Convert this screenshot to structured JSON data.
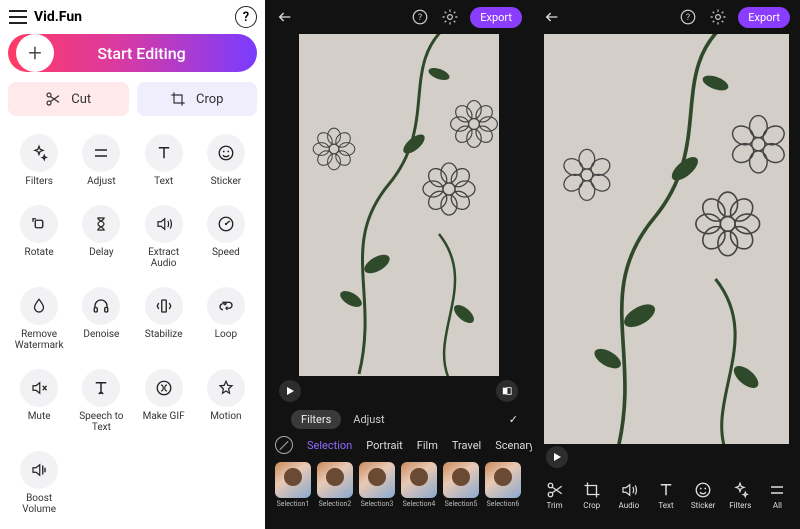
{
  "panel_left": {
    "brand": "Vid.Fun",
    "start_label": "Start Editing",
    "cut_label": "Cut",
    "crop_label": "Crop",
    "tools": [
      {
        "name": "filters",
        "label": "Filters",
        "icon": "sparkle"
      },
      {
        "name": "adjust",
        "label": "Adjust",
        "icon": "equals"
      },
      {
        "name": "text",
        "label": "Text",
        "icon": "text"
      },
      {
        "name": "sticker",
        "label": "Sticker",
        "icon": "smile"
      },
      {
        "name": "rotate",
        "label": "Rotate",
        "icon": "rotate"
      },
      {
        "name": "delay",
        "label": "Delay",
        "icon": "hourglass"
      },
      {
        "name": "extract-audio",
        "label": "Extract Audio",
        "icon": "volume"
      },
      {
        "name": "speed",
        "label": "Speed",
        "icon": "gauge"
      },
      {
        "name": "remove-watermark",
        "label": "Remove Watermark",
        "icon": "drop"
      },
      {
        "name": "denoise",
        "label": "Denoise",
        "icon": "headphones"
      },
      {
        "name": "stabilize",
        "label": "Stabilize",
        "icon": "stabilize"
      },
      {
        "name": "loop",
        "label": "Loop",
        "icon": "loop"
      },
      {
        "name": "mute",
        "label": "Mute",
        "icon": "mute"
      },
      {
        "name": "speech-to-text",
        "label": "Speech to Text",
        "icon": "stt"
      },
      {
        "name": "make-gif",
        "label": "Make GIF",
        "icon": "gif"
      },
      {
        "name": "motion",
        "label": "Motion",
        "icon": "star"
      },
      {
        "name": "boost-volume",
        "label": "Boost Volume",
        "icon": "boost"
      }
    ]
  },
  "panel_center": {
    "export_label": "Export",
    "tab_filters": "Filters",
    "tab_adjust": "Adjust",
    "categories": [
      "Selection",
      "Portrait",
      "Film",
      "Travel",
      "Scenary"
    ],
    "thumbs": [
      "Selection1",
      "Selection2",
      "Selection3",
      "Selection4",
      "Selection5",
      "Selection6"
    ]
  },
  "panel_right": {
    "export_label": "Export",
    "bottom_tools": [
      {
        "name": "trim",
        "label": "Trim",
        "icon": "scissors"
      },
      {
        "name": "crop",
        "label": "Crop",
        "icon": "crop"
      },
      {
        "name": "audio",
        "label": "Audio",
        "icon": "volume"
      },
      {
        "name": "text",
        "label": "Text",
        "icon": "text"
      },
      {
        "name": "sticker",
        "label": "Sticker",
        "icon": "smile"
      },
      {
        "name": "filters",
        "label": "Filters",
        "icon": "sparkle"
      },
      {
        "name": "all",
        "label": "All",
        "icon": "equals"
      }
    ]
  },
  "colors": {
    "accent": "#8b3dff",
    "gradient_start": "#ff3b65",
    "gradient_end": "#7a3cff"
  }
}
